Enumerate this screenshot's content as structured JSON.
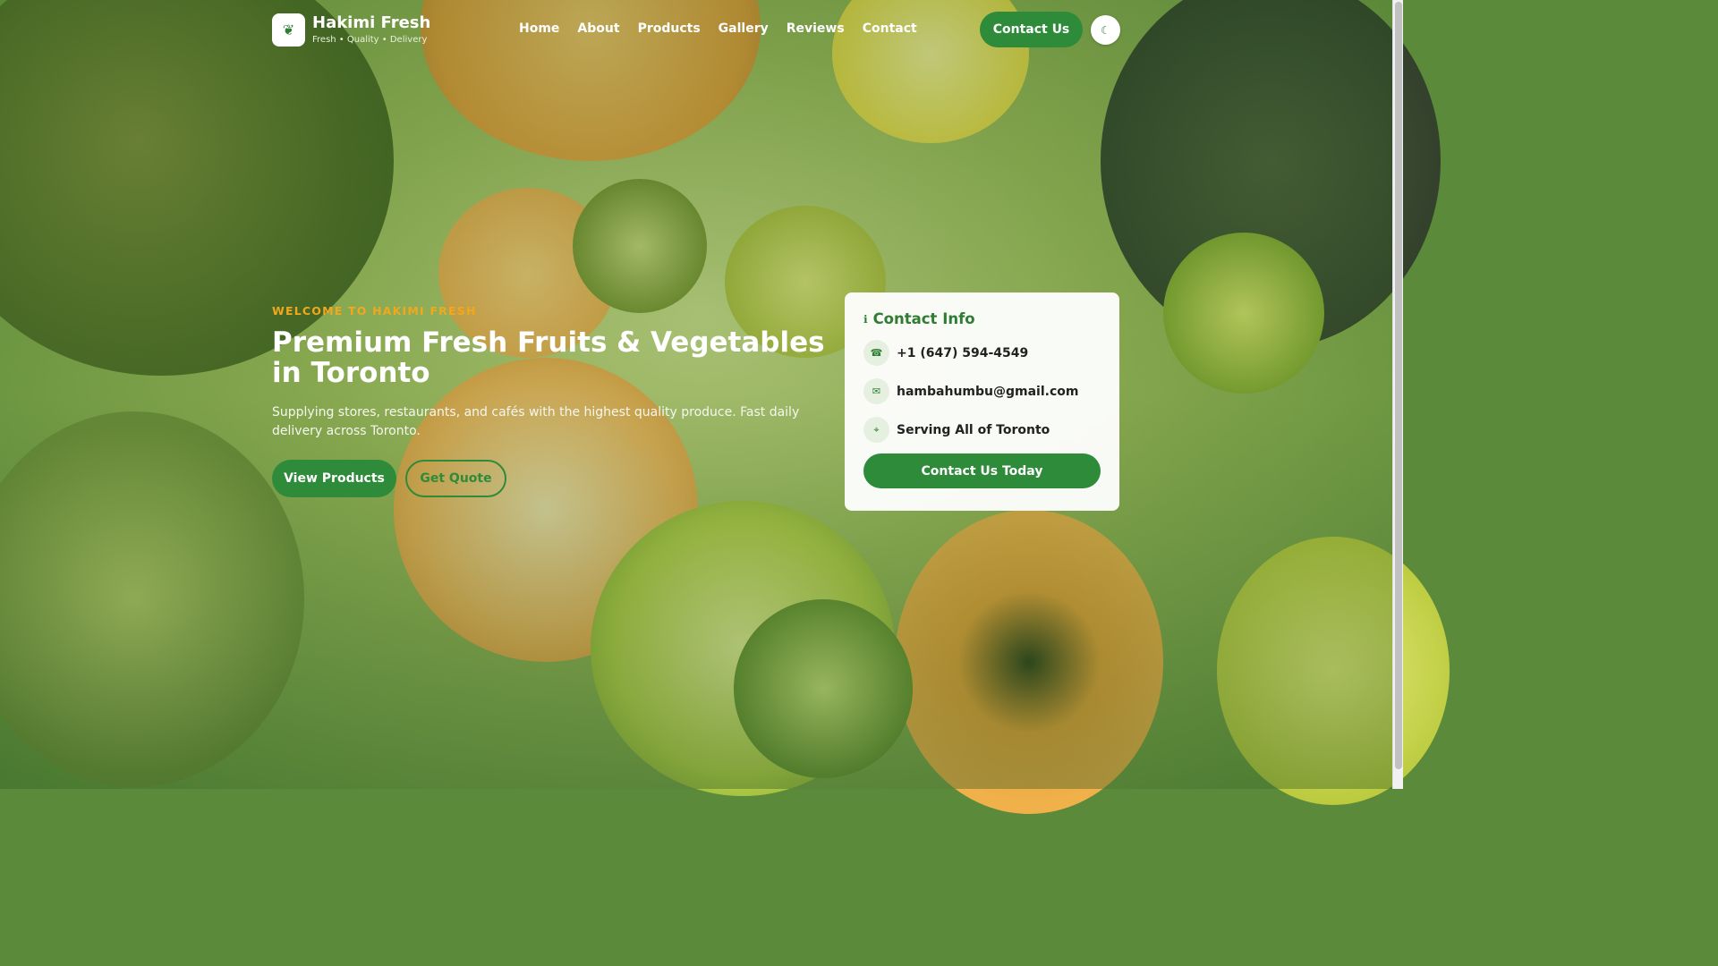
{
  "brand": {
    "name": "Hakimi Fresh",
    "tagline": "Fresh • Quality • Delivery",
    "logo_icon": "leaf-icon"
  },
  "nav": {
    "items": [
      {
        "label": "Home"
      },
      {
        "label": "About"
      },
      {
        "label": "Products"
      },
      {
        "label": "Gallery"
      },
      {
        "label": "Reviews"
      },
      {
        "label": "Contact"
      }
    ],
    "cta_label": "Contact Us",
    "menu_icon": "theme-toggle-icon"
  },
  "hero": {
    "eyebrow": "WELCOME TO HAKIMI FRESH",
    "title": "Premium Fresh Fruits & Vegetables in Toronto",
    "subtitle": "Supplying stores, restaurants, and cafés with the highest quality produce. Fast daily delivery across Toronto.",
    "primary_button": "View Products",
    "secondary_button": "Get Quote"
  },
  "contact_card": {
    "title": "Contact Info",
    "phone": "+1 (647) 594-4549",
    "email": "hambahumbu@gmail.com",
    "area": "Serving All of Toronto",
    "cta": "Contact Us Today"
  },
  "colors": {
    "accent_green": "#2e8b3a",
    "eyebrow_orange": "#f2a81d",
    "card_bg": "#ffffff"
  }
}
